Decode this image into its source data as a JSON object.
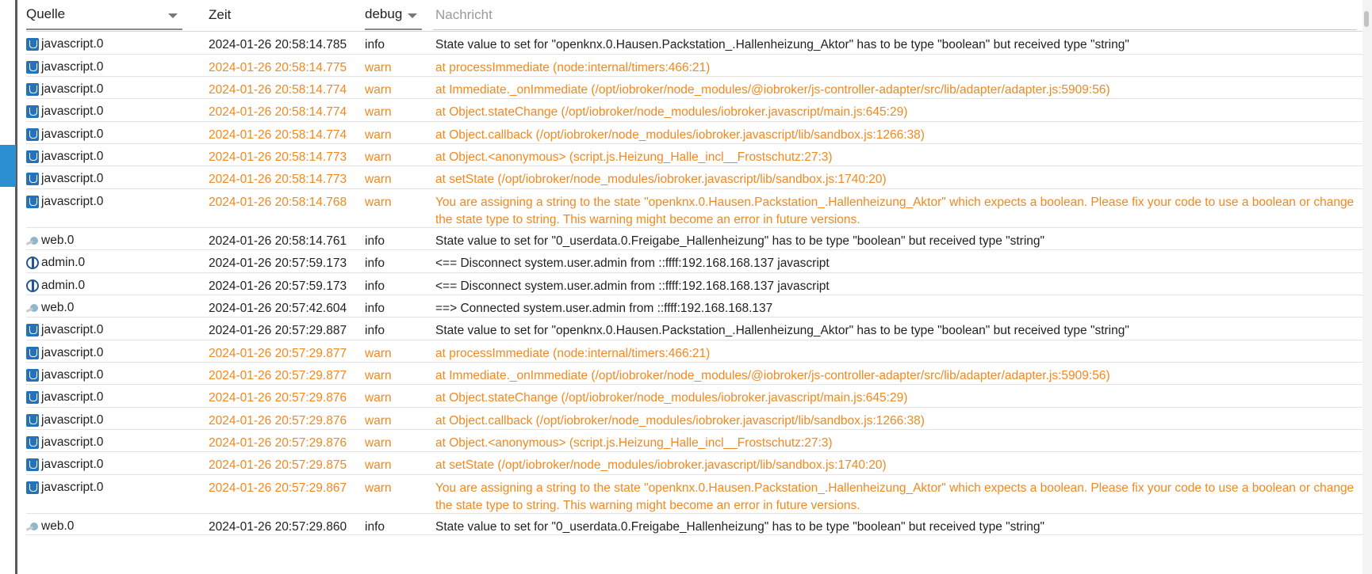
{
  "header": {
    "source_label": "Quelle",
    "time_label": "Zeit",
    "severity_label": "debug",
    "message_placeholder": "Nachricht"
  },
  "rows": [
    {
      "icon": "javascript-icon",
      "source": "javascript.0",
      "time": "2024-01-26 20:58:14.785",
      "severity": "info",
      "message": "State value to set for \"openknx.0.Hausen.Packstation_.Hallenheizung_Aktor\" has to be type \"boolean\" but received type \"string\""
    },
    {
      "icon": "javascript-icon",
      "source": "javascript.0",
      "time": "2024-01-26 20:58:14.775",
      "severity": "warn",
      "message": "at processImmediate (node:internal/timers:466:21)"
    },
    {
      "icon": "javascript-icon",
      "source": "javascript.0",
      "time": "2024-01-26 20:58:14.774",
      "severity": "warn",
      "message": "at Immediate._onImmediate (/opt/iobroker/node_modules/@iobroker/js-controller-adapter/src/lib/adapter/adapter.js:5909:56)"
    },
    {
      "icon": "javascript-icon",
      "source": "javascript.0",
      "time": "2024-01-26 20:58:14.774",
      "severity": "warn",
      "message": "at Object.stateChange (/opt/iobroker/node_modules/iobroker.javascript/main.js:645:29)"
    },
    {
      "icon": "javascript-icon",
      "source": "javascript.0",
      "time": "2024-01-26 20:58:14.774",
      "severity": "warn",
      "message": "at Object.callback (/opt/iobroker/node_modules/iobroker.javascript/lib/sandbox.js:1266:38)"
    },
    {
      "icon": "javascript-icon",
      "source": "javascript.0",
      "time": "2024-01-26 20:58:14.773",
      "severity": "warn",
      "message": "at Object.<anonymous> (script.js.Heizung_Halle_incl__Frostschutz:27:3)"
    },
    {
      "icon": "javascript-icon",
      "source": "javascript.0",
      "time": "2024-01-26 20:58:14.773",
      "severity": "warn",
      "message": "at setState (/opt/iobroker/node_modules/iobroker.javascript/lib/sandbox.js:1740:20)"
    },
    {
      "icon": "javascript-icon",
      "source": "javascript.0",
      "time": "2024-01-26 20:58:14.768",
      "severity": "warn",
      "message": "You are assigning a string to the state \"openknx.0.Hausen.Packstation_.Hallenheizung_Aktor\" which expects a boolean. Please fix your code to use a boolean or change the state type to string. This warning might become an error in future versions."
    },
    {
      "icon": "web-icon",
      "source": "web.0",
      "time": "2024-01-26 20:58:14.761",
      "severity": "info",
      "message": "State value to set for \"0_userdata.0.Freigabe_Hallenheizung\" has to be type \"boolean\" but received type \"string\""
    },
    {
      "icon": "admin-icon",
      "source": "admin.0",
      "time": "2024-01-26 20:57:59.173",
      "severity": "info",
      "message": "<== Disconnect system.user.admin from ::ffff:192.168.168.137 javascript"
    },
    {
      "icon": "admin-icon",
      "source": "admin.0",
      "time": "2024-01-26 20:57:59.173",
      "severity": "info",
      "message": "<== Disconnect system.user.admin from ::ffff:192.168.168.137 javascript"
    },
    {
      "icon": "web-icon",
      "source": "web.0",
      "time": "2024-01-26 20:57:42.604",
      "severity": "info",
      "message": "==> Connected system.user.admin from ::ffff:192.168.168.137"
    },
    {
      "icon": "javascript-icon",
      "source": "javascript.0",
      "time": "2024-01-26 20:57:29.887",
      "severity": "info",
      "message": "State value to set for \"openknx.0.Hausen.Packstation_.Hallenheizung_Aktor\" has to be type \"boolean\" but received type \"string\""
    },
    {
      "icon": "javascript-icon",
      "source": "javascript.0",
      "time": "2024-01-26 20:57:29.877",
      "severity": "warn",
      "message": "at processImmediate (node:internal/timers:466:21)"
    },
    {
      "icon": "javascript-icon",
      "source": "javascript.0",
      "time": "2024-01-26 20:57:29.877",
      "severity": "warn",
      "message": "at Immediate._onImmediate (/opt/iobroker/node_modules/@iobroker/js-controller-adapter/src/lib/adapter/adapter.js:5909:56)"
    },
    {
      "icon": "javascript-icon",
      "source": "javascript.0",
      "time": "2024-01-26 20:57:29.876",
      "severity": "warn",
      "message": "at Object.stateChange (/opt/iobroker/node_modules/iobroker.javascript/main.js:645:29)"
    },
    {
      "icon": "javascript-icon",
      "source": "javascript.0",
      "time": "2024-01-26 20:57:29.876",
      "severity": "warn",
      "message": "at Object.callback (/opt/iobroker/node_modules/iobroker.javascript/lib/sandbox.js:1266:38)"
    },
    {
      "icon": "javascript-icon",
      "source": "javascript.0",
      "time": "2024-01-26 20:57:29.876",
      "severity": "warn",
      "message": "at Object.<anonymous> (script.js.Heizung_Halle_incl__Frostschutz:27:3)"
    },
    {
      "icon": "javascript-icon",
      "source": "javascript.0",
      "time": "2024-01-26 20:57:29.875",
      "severity": "warn",
      "message": "at setState (/opt/iobroker/node_modules/iobroker.javascript/lib/sandbox.js:1740:20)"
    },
    {
      "icon": "javascript-icon",
      "source": "javascript.0",
      "time": "2024-01-26 20:57:29.867",
      "severity": "warn",
      "message": "You are assigning a string to the state \"openknx.0.Hausen.Packstation_.Hallenheizung_Aktor\" which expects a boolean. Please fix your code to use a boolean or change the state type to string. This warning might become an error in future versions."
    },
    {
      "icon": "web-icon",
      "source": "web.0",
      "time": "2024-01-26 20:57:29.860",
      "severity": "info",
      "message": "State value to set for \"0_userdata.0.Freigabe_Hallenheizung\" has to be type \"boolean\" but received type \"string\""
    }
  ],
  "colors": {
    "warn": "#f2881e",
    "info": "#222222",
    "accent": "#2b8fd0"
  }
}
